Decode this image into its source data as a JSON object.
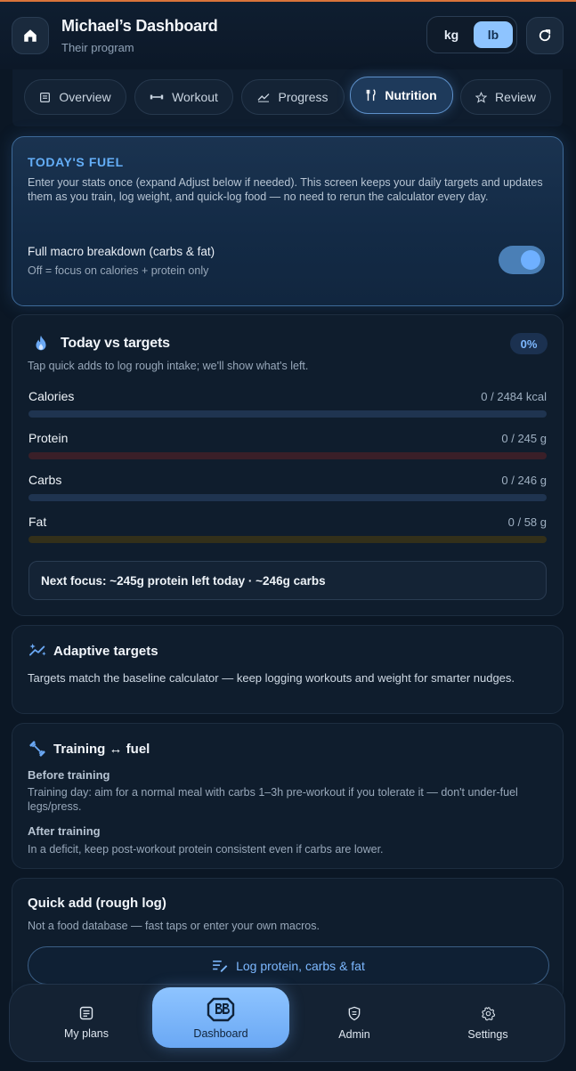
{
  "header": {
    "title": "Michael’s Dashboard",
    "subtitle": "Their program",
    "units": {
      "kg": "kg",
      "lb": "lb",
      "selected": "lb"
    }
  },
  "tabs": [
    {
      "label": "Overview",
      "icon": "overview-icon"
    },
    {
      "label": "Workout",
      "icon": "dumbbell-icon"
    },
    {
      "label": "Progress",
      "icon": "trend-icon"
    },
    {
      "label": "Nutrition",
      "icon": "utensils-icon",
      "active": true
    },
    {
      "label": "Review",
      "icon": "star-icon"
    }
  ],
  "fuel": {
    "title": "TODAY'S FUEL",
    "description": "Enter your stats once (expand Adjust below if needed). This screen keeps your daily targets and updates them as you train, log weight, and quick-log food — no need to rerun the calculator every day.",
    "macro_label": "Full macro breakdown (carbs & fat)",
    "macro_sub": "Off = focus on calories + protein only",
    "macro_toggle_on": true
  },
  "targets": {
    "title": "Today vs targets",
    "percent": "0%",
    "description": "Tap quick adds to log rough intake; we'll show what's left.",
    "rows": [
      {
        "label": "Calories",
        "value": "0 / 2484 kcal",
        "progress": 0,
        "track_color": "#1f3450",
        "fill_color": "#6aa8f4"
      },
      {
        "label": "Protein",
        "value": "0 / 245 g",
        "progress": 0,
        "track_color": "#3a1f28",
        "fill_color": "#e0606a"
      },
      {
        "label": "Carbs",
        "value": "0 / 246 g",
        "progress": 0,
        "track_color": "#1f3450",
        "fill_color": "#6aa8f4"
      },
      {
        "label": "Fat",
        "value": "0 / 58 g",
        "progress": 0,
        "track_color": "#33301a",
        "fill_color": "#d6b24a"
      }
    ],
    "next_focus": "Next focus: ~245g protein left today · ~246g carbs"
  },
  "adaptive": {
    "title": "Adaptive targets",
    "description": "Targets match the baseline calculator — keep logging workouts and weight for smarter nudges."
  },
  "training": {
    "title": "Training ↔ fuel",
    "before_title": "Before training",
    "before_text": "Training day: aim for a normal meal with carbs 1–3h pre-workout if you tolerate it — don't under-fuel legs/press.",
    "after_title": "After training",
    "after_text": "In a deficit, keep post-workout protein consistent even if carbs are lower."
  },
  "quick_add": {
    "title": "Quick add (rough log)",
    "description": "Not a food database — fast taps or enter your own macros.",
    "button_label": "Log protein, carbs & fat"
  },
  "bottom_nav": [
    {
      "label": "My plans",
      "icon": "list-icon"
    },
    {
      "label": "Dashboard",
      "icon": "bb-logo-icon",
      "active": true
    },
    {
      "label": "Admin",
      "icon": "shield-icon"
    },
    {
      "label": "Settings",
      "icon": "gear-icon"
    }
  ],
  "colors": {
    "accent": "#6aa8f4",
    "background": "#0b1725",
    "top_accent": "#d9743a"
  }
}
